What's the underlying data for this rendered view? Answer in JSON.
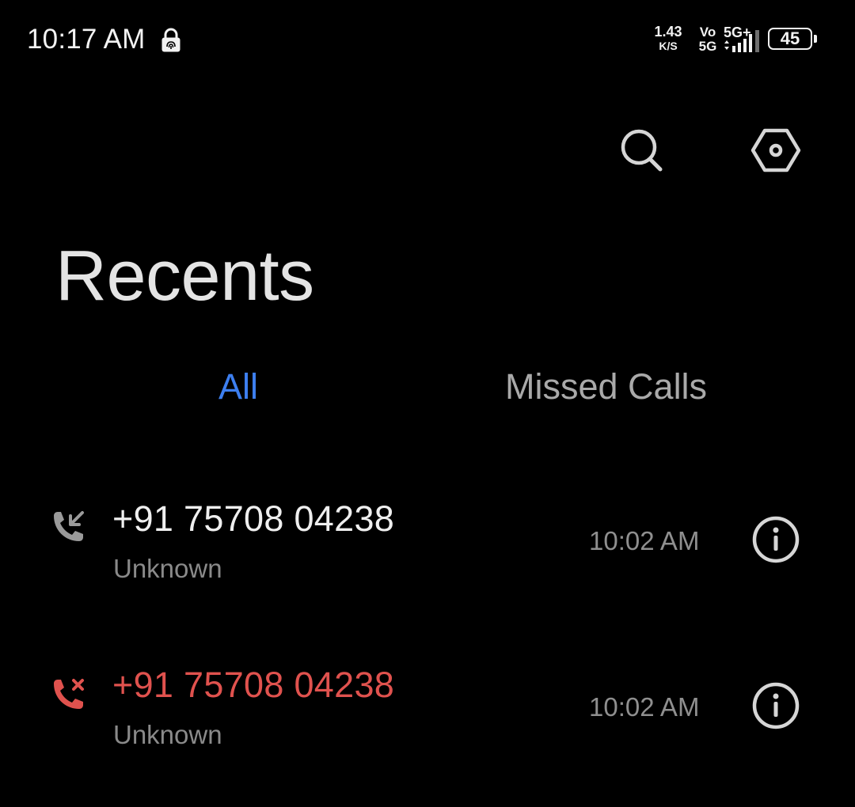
{
  "status_bar": {
    "time": "10:17 AM",
    "net_speed_value": "1.43",
    "net_speed_unit": "K/S",
    "volte_top": "Vo",
    "volte_bottom": "5G",
    "network_type": "5G+",
    "battery_level": "45",
    "icons": [
      "fingerprint-lock-icon",
      "signal-icon",
      "battery-icon"
    ]
  },
  "toolbar": {
    "icons": [
      "search-icon",
      "settings-icon"
    ]
  },
  "page": {
    "title": "Recents"
  },
  "tabs": [
    {
      "label": "All",
      "selected": true
    },
    {
      "label": "Missed Calls",
      "selected": false
    }
  ],
  "calls": [
    {
      "number": "+91 75708 04238",
      "label": "Unknown",
      "time": "10:02 AM",
      "type": "incoming",
      "icon": "incoming-call-icon"
    },
    {
      "number": "+91 75708 04238",
      "label": "Unknown",
      "time": "10:02 AM",
      "type": "missed",
      "icon": "missed-call-icon"
    }
  ],
  "colors": {
    "background": "#000000",
    "accent": "#3d7ff0",
    "missed": "#e0524e",
    "secondary_text": "#8a8a8a"
  }
}
